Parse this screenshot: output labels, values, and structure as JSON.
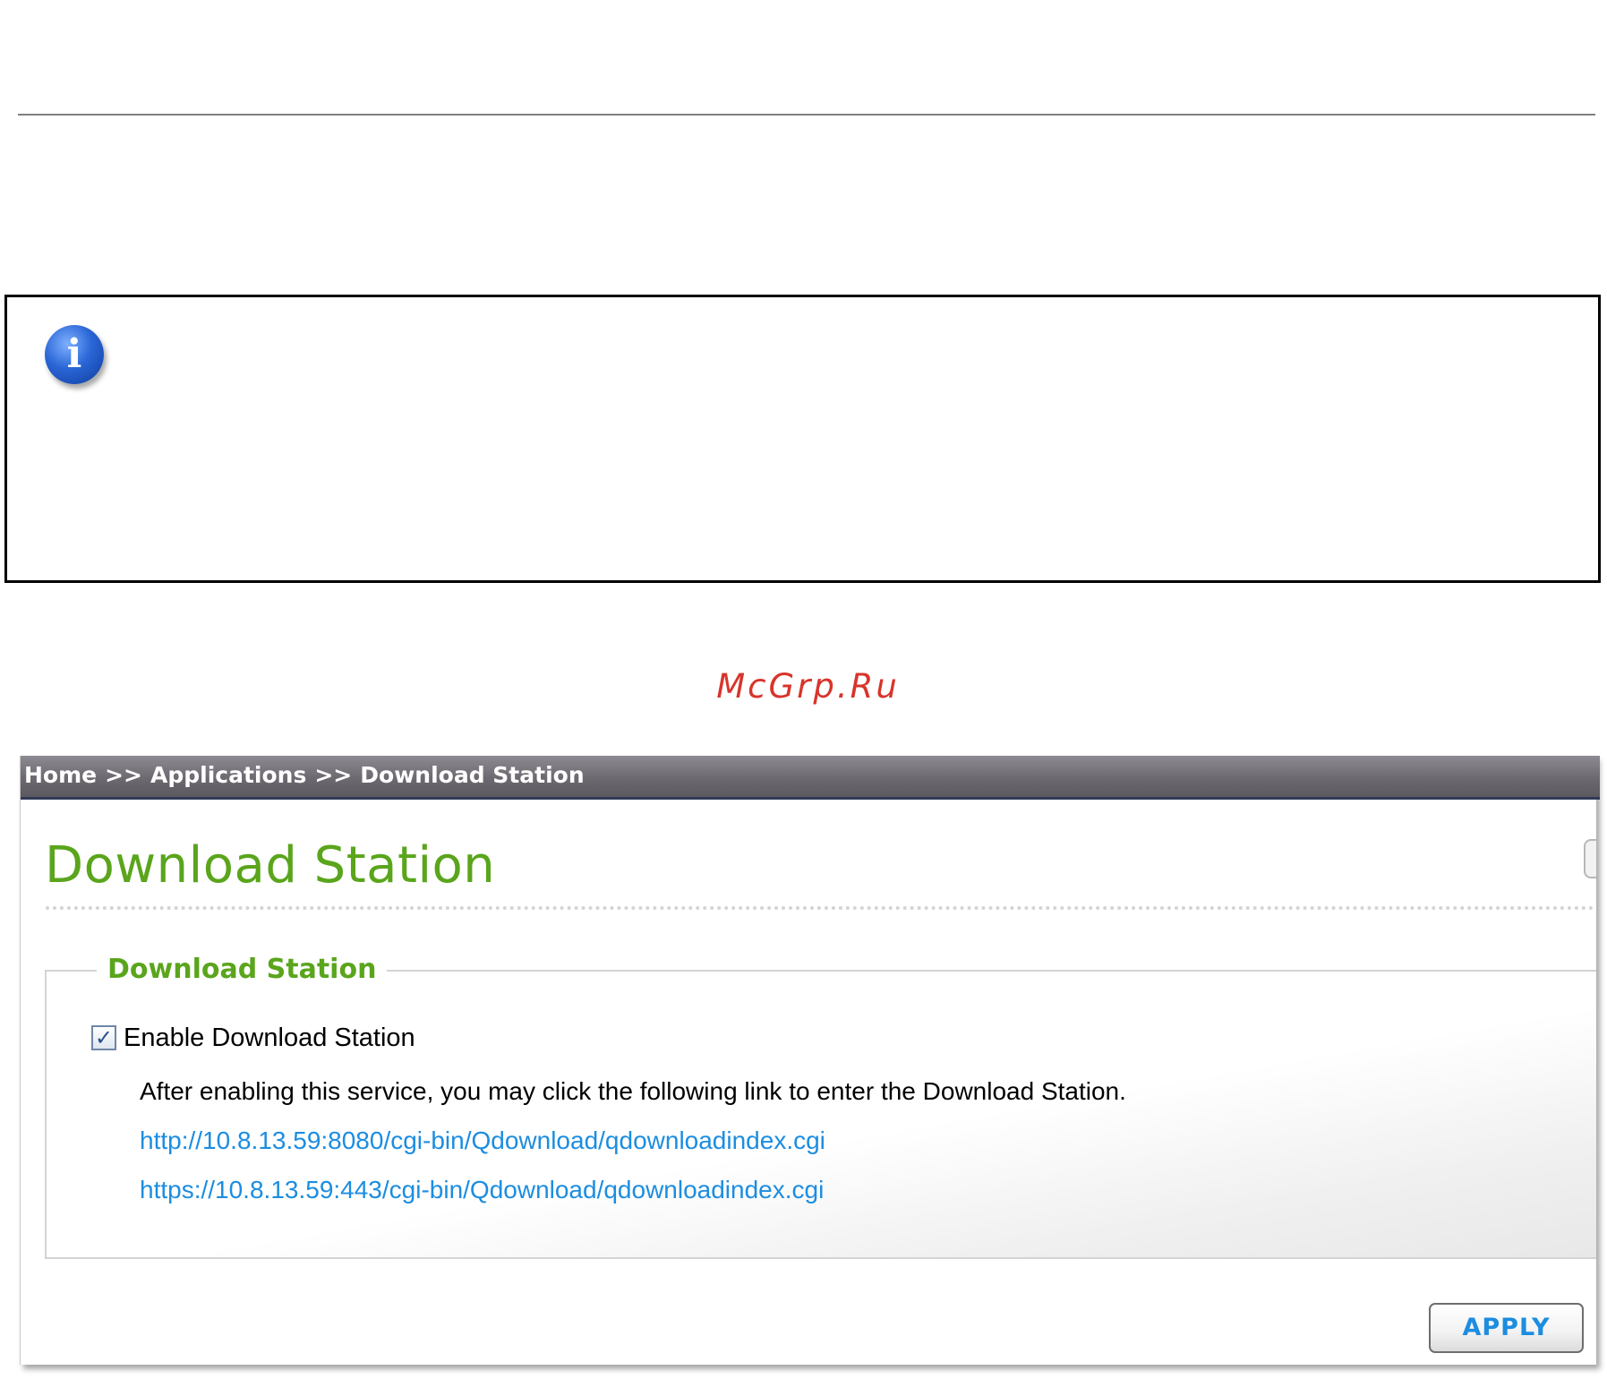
{
  "watermark": "McGrp.Ru",
  "info_box": {
    "icon": "info-icon",
    "icon_glyph": "i"
  },
  "breadcrumb": {
    "items": [
      "Home",
      "Applications",
      "Download Station"
    ],
    "separator": ">>"
  },
  "page": {
    "title": "Download Station"
  },
  "section": {
    "legend": "Download Station",
    "enable_label": "Enable Download Station",
    "enable_checked": true,
    "checkbox_glyph": "✓",
    "helper_text": "After enabling this service, you may click the following link to enter the Download Station.",
    "links": [
      "http://10.8.13.59:8080/cgi-bin/Qdownload/qdownloadindex.cgi",
      "https://10.8.13.59:443/cgi-bin/Qdownload/qdownloadindex.cgi"
    ]
  },
  "actions": {
    "apply_label": "APPLY"
  },
  "colors": {
    "accent_green": "#5aa51c",
    "link_blue": "#1c8de0",
    "watermark_red": "#d8342b",
    "breadcrumb_bar": "#6d6970"
  }
}
